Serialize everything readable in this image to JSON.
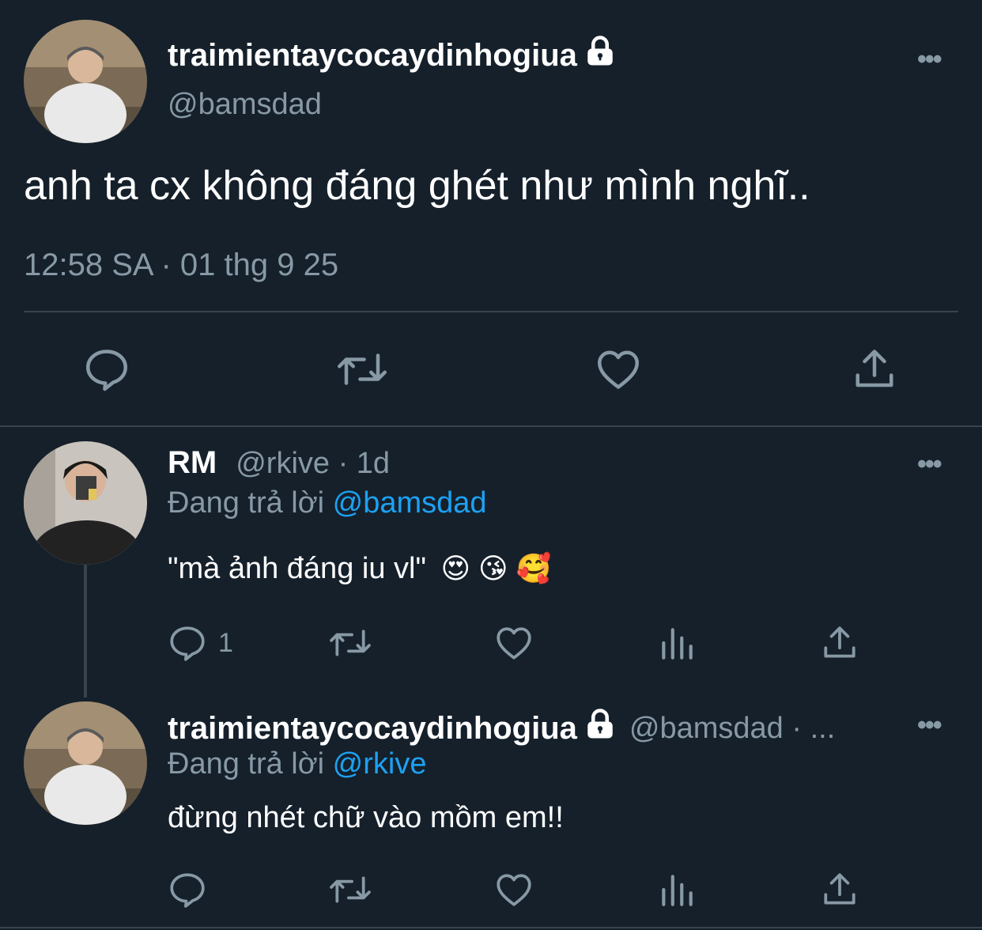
{
  "main_tweet": {
    "display_name": "traimientaycocaydinhogiua",
    "handle": "@bamsdad",
    "text": "anh ta cx không đáng ghét như mình nghĩ..",
    "timestamp": "12:58 SA · 01 thg 9 25",
    "more": "•••",
    "icons": [
      "lock-icon",
      "reply-icon",
      "retweet-icon",
      "like-icon",
      "share-icon"
    ]
  },
  "reply1": {
    "display_name": "RM",
    "handle_time": "@rkive · 1d",
    "replying_prefix": "Đang trả lời",
    "replying_to": "@bamsdad",
    "text": "\"mà ảnh đáng iu vl\"",
    "emojis": "😍 😘 🥰",
    "reply_count": "1",
    "more": "•••"
  },
  "reply2": {
    "display_name": "traimientaycocaydinhogiua",
    "handle_time": "@bamsdad · ...",
    "replying_prefix": "Đang trả lời",
    "replying_to": "@rkive",
    "text": "đừng nhét chữ vào mồm em!!",
    "more": "•••"
  },
  "colors": {
    "background": "#15202b",
    "muted": "#8899a6",
    "accent": "#1da1f2",
    "divider": "#38444d"
  }
}
